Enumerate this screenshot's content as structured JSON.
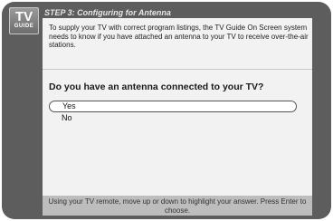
{
  "logo": {
    "line1": "TV",
    "line2": "GUIDE"
  },
  "header": {
    "title": "STEP 3: Configuring for Antenna"
  },
  "content": {
    "intro": "To supply your TV with correct program listings, the TV Guide On Screen system needs to know if you have attached an antenna to your TV to receive over-the-air stations.",
    "question": "Do you have an antenna connected to your TV?",
    "answers": [
      {
        "label": "Yes",
        "selected": true
      },
      {
        "label": "No",
        "selected": false
      }
    ]
  },
  "footer": {
    "text": "Using your TV remote, move up or down to highlight your answer. Press Enter to choose."
  }
}
